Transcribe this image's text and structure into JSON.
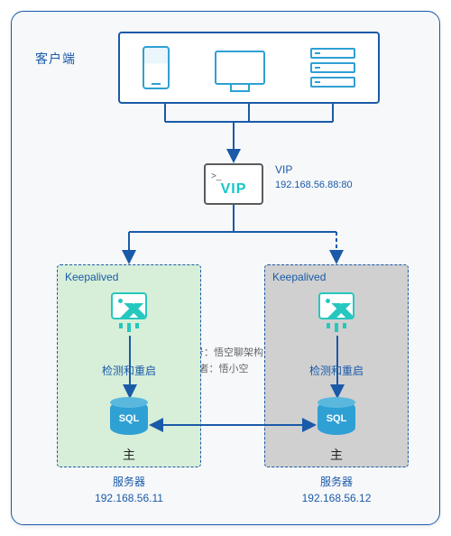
{
  "clients_label": "客户端",
  "vip": {
    "badge": "VIP",
    "label": "VIP",
    "address": "192.168.56.88:80"
  },
  "watermark": {
    "line1": "公众号：悟空聊架构",
    "line2": "作者：悟小空"
  },
  "keepalived_title": "Keepalived",
  "check_label": "检测和重启",
  "sql_label": "SQL",
  "master_label": "主",
  "servers": {
    "left": {
      "title": "服务器",
      "addr": "192.168.56.11"
    },
    "right": {
      "title": "服务器",
      "addr": "192.168.56.12"
    }
  }
}
